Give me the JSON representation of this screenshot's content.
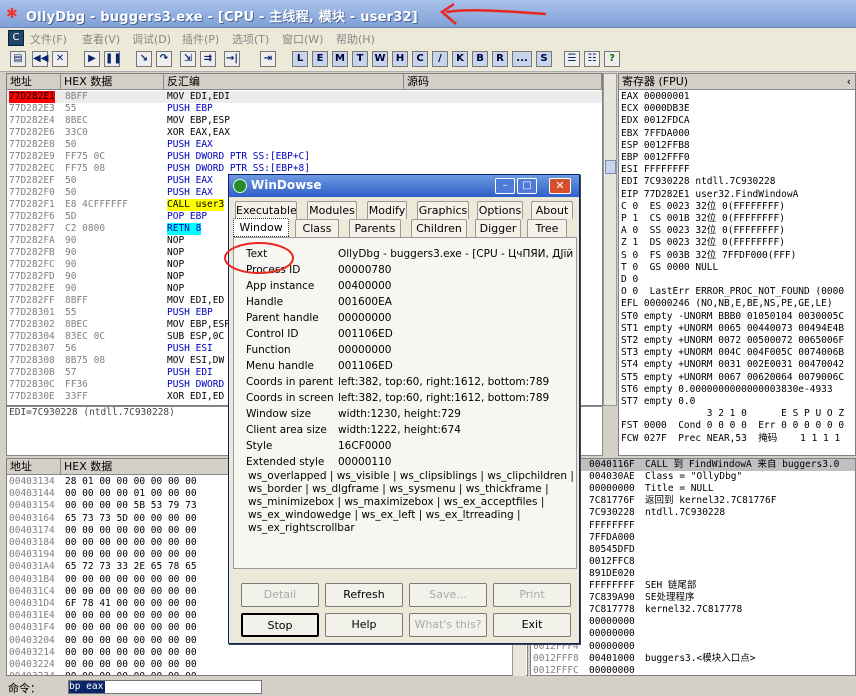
{
  "app": {
    "title": "OllyDbg - buggers3.exe - [CPU - 主线程, 模块 - user32]"
  },
  "menu": [
    "文件(F)",
    "查看(V)",
    "调试(D)",
    "插件(P)",
    "选项(T)",
    "窗口(W)",
    "帮助(H)"
  ],
  "toolbar_letters": [
    "L",
    "E",
    "M",
    "T",
    "W",
    "H",
    "C",
    "/",
    "K",
    "B",
    "R",
    "...",
    "S"
  ],
  "disasm": {
    "headers": [
      "地址",
      "HEX 数据",
      "反汇编",
      "源码"
    ],
    "rows": [
      [
        "77D282E1",
        "8BFF",
        "MOV EDI,EDI"
      ],
      [
        "77D282E3",
        "55",
        "PUSH EBP"
      ],
      [
        "77D282E4",
        "8BEC",
        "MOV EBP,ESP"
      ],
      [
        "77D282E6",
        "33C0",
        "XOR EAX,EAX"
      ],
      [
        "77D282E8",
        "50",
        "PUSH EAX"
      ],
      [
        "77D282E9",
        "FF75 0C",
        "PUSH DWORD PTR SS:[EBP+C]"
      ],
      [
        "77D282EC",
        "FF75 08",
        "PUSH DWORD PTR SS:[EBP+8]"
      ],
      [
        "77D282EF",
        "50",
        "PUSH EAX"
      ],
      [
        "77D282F0",
        "50",
        "PUSH EAX"
      ],
      [
        "77D282F1",
        "E8 4CFFFFFF",
        "CALL user3"
      ],
      [
        "77D282F6",
        "5D",
        "POP EBP"
      ],
      [
        "77D282F7",
        "C2 0800",
        "RETN 8"
      ],
      [
        "77D282FA",
        "90",
        "NOP"
      ],
      [
        "77D282FB",
        "90",
        "NOP"
      ],
      [
        "77D282FC",
        "90",
        "NOP"
      ],
      [
        "77D282FD",
        "90",
        "NOP"
      ],
      [
        "77D282FE",
        "90",
        "NOP"
      ],
      [
        "77D282FF",
        "8BFF",
        "MOV EDI,ED"
      ],
      [
        "77D28301",
        "55",
        "PUSH EBP"
      ],
      [
        "77D28302",
        "8BEC",
        "MOV EBP,ESP"
      ],
      [
        "77D28304",
        "83EC 0C",
        "SUB ESP,0C"
      ],
      [
        "77D28307",
        "56",
        "PUSH ESI"
      ],
      [
        "77D28308",
        "8B75 08",
        "MOV ESI,DW"
      ],
      [
        "77D2830B",
        "57",
        "PUSH EDI"
      ],
      [
        "77D2830C",
        "FF36",
        "PUSH DWORD"
      ],
      [
        "77D2830E",
        "33FF",
        "XOR EDI,ED"
      ]
    ],
    "info": "EDI=7C930228 (ntdll.7C930228)"
  },
  "registers": {
    "title": "寄存器 (FPU)",
    "lines": [
      "EAX 00000001",
      "ECX 0000DB3E",
      "EDX 0012FDCA",
      "EBX 7FFDA000",
      "ESP 0012FFB8",
      "EBP 0012FFF0",
      "ESI FFFFFFFF",
      "EDI 7C930228 ntdll.7C930228",
      "",
      "EIP 77D282E1 user32.FindWindowA",
      "",
      "C 0  ES 0023 32位 0(FFFFFFFF)",
      "P 1  CS 001B 32位 0(FFFFFFFF)",
      "A 0  SS 0023 32位 0(FFFFFFFF)",
      "Z 1  DS 0023 32位 0(FFFFFFFF)",
      "S 0  FS 003B 32位 7FFDF000(FFF)",
      "T 0  GS 0000 NULL",
      "D 0",
      "O 0  LastErr ERROR_PROC_NOT_FOUND (0000",
      "",
      "EFL 00000246 (NO,NB,E,BE,NS,PE,GE,LE)",
      "",
      "ST0 empty -UNORM BBB0 01050104 0030005C",
      "ST1 empty +UNORM 0065 00440073 00494E4B",
      "ST2 empty +UNORM 0072 00500072 0065006F",
      "ST3 empty +UNORM 004C 004F005C 0074006B",
      "ST4 empty +UNORM 0031 002E0031 00470042",
      "ST5 empty +UNORM 0067 00620064 0079006C",
      "ST6 empty 0.0000000000000003830e-4933",
      "ST7 empty 0.0",
      "",
      "               3 2 1 0      E S P U O Z",
      "FST 0000  Cond 0 0 0 0  Err 0 0 0 0 0 0",
      "FCW 027F  Prec NEAR,53  掩码    1 1 1 1"
    ]
  },
  "dump": {
    "headers": [
      "地址",
      "HEX 数据"
    ],
    "rows": [
      [
        "00403134",
        "28 01 00 00 00 00 00 00"
      ],
      [
        "00403144",
        "00 00 00 00 01 00 00 00"
      ],
      [
        "00403154",
        "00 00 00 00 5B 53 79 73"
      ],
      [
        "00403164",
        "65 73 73 5D 00 00 00 00"
      ],
      [
        "00403174",
        "00 00 00 00 00 00 00 00"
      ],
      [
        "00403184",
        "00 00 00 00 00 00 00 00"
      ],
      [
        "00403194",
        "00 00 00 00 00 00 00 00"
      ],
      [
        "004031A4",
        "65 72 73 33 2E 65 78 65"
      ],
      [
        "004031B4",
        "00 00 00 00 00 00 00 00"
      ],
      [
        "004031C4",
        "00 00 00 00 00 00 00 00"
      ],
      [
        "004031D4",
        "6F 78 41 00 00 00 00 00"
      ],
      [
        "004031E4",
        "00 00 00 00 00 00 00 00"
      ],
      [
        "004031F4",
        "00 00 00 00 00 00 00 00"
      ],
      [
        "00403204",
        "00 00 00 00 00 00 00 00"
      ],
      [
        "00403214",
        "00 00 00 00 00 00 00 00"
      ],
      [
        "00403224",
        "00 00 00 00 00 00 00 00"
      ],
      [
        "00403234",
        "00 00 00 00 00 00 00 00"
      ]
    ]
  },
  "stack": {
    "rows": [
      [
        "0012FFB8",
        "0040116F",
        "CALL 到 FindWindowA 来自 buggers3.0"
      ],
      [
        "0012FFBC",
        "004030AE",
        "Class = \"OllyDbg\""
      ],
      [
        "0012FFC0",
        "00000000",
        "Title = NULL"
      ],
      [
        "0012FFC4",
        "7C81776F",
        "返回到 kernel32.7C81776F"
      ],
      [
        "0012FFC8",
        "7C930228",
        "ntdll.7C930228"
      ],
      [
        "0012FFCC",
        "FFFFFFFF",
        ""
      ],
      [
        "0012FFD0",
        "7FFDA000",
        ""
      ],
      [
        "0012FFD4",
        "80545DFD",
        ""
      ],
      [
        "0012FFD8",
        "0012FFC8",
        ""
      ],
      [
        "0012FFDC",
        "891DE020",
        ""
      ],
      [
        "0012FFE0",
        "FFFFFFFF",
        "SEH 链尾部"
      ],
      [
        "0012FFE4",
        "7C839A90",
        "SE处理程序"
      ],
      [
        "0012FFE8",
        "7C817778",
        "kernel32.7C817778"
      ],
      [
        "0012FFEC",
        "00000000",
        ""
      ],
      [
        "0012FFF0",
        "00000000",
        ""
      ],
      [
        "0012FFF4",
        "00000000",
        ""
      ],
      [
        "0012FFF8",
        "00401000",
        "buggers3.<模块入口点>"
      ],
      [
        "0012FFFC",
        "00000000",
        ""
      ]
    ]
  },
  "command": {
    "label": "命令：",
    "value": "bp eax"
  },
  "windowse": {
    "title": "WinDowse",
    "tabs_row1": [
      "Executable",
      "Modules",
      "Modify",
      "Graphics",
      "Options",
      "About"
    ],
    "tabs_row2": [
      "Window",
      "Class",
      "Parents",
      "Children",
      "Digger",
      "Tree"
    ],
    "props": [
      [
        "Text",
        "OllyDbg - buggers3.exe - [CPU - ЦчПЯИ, ДЈїй - ι"
      ],
      [
        "Process ID",
        "00000780"
      ],
      [
        "App instance",
        "00400000"
      ],
      [
        "Handle",
        "001600EA"
      ],
      [
        "Parent handle",
        "00000000"
      ],
      [
        "Control ID",
        "001106ED"
      ],
      [
        "Function",
        "00000000"
      ],
      [
        "Menu handle",
        "001106ED"
      ],
      [
        "Coords in parent",
        "left:382, top:60, right:1612, bottom:789"
      ],
      [
        "Coords in screen",
        "left:382, top:60, right:1612, bottom:789"
      ],
      [
        "Window size",
        "width:1230, height:729"
      ],
      [
        "Client area size",
        "width:1222, height:674"
      ],
      [
        "Style",
        "16CF0000"
      ],
      [
        "Extended style",
        "00000110"
      ]
    ],
    "styles": [
      "ws_overlapped | ws_visible | ws_clipsiblings | ws_clipchildren |",
      "ws_border | ws_dlgframe | ws_sysmenu | ws_thickframe |",
      "ws_minimizebox | ws_maximizebox | ws_ex_acceptfiles |",
      "ws_ex_windowedge | ws_ex_left | ws_ex_ltrreading |",
      "ws_ex_rightscrollbar"
    ],
    "buttons_row1": [
      "Detail",
      "Refresh",
      "Save...",
      "Print"
    ],
    "buttons_row2": [
      "Stop",
      "Help",
      "What's this?",
      "Exit"
    ]
  },
  "colors": {
    "annotation": "#e8281e",
    "title_bg": "#7f9fd6",
    "eip_hl": "#ff0000"
  }
}
